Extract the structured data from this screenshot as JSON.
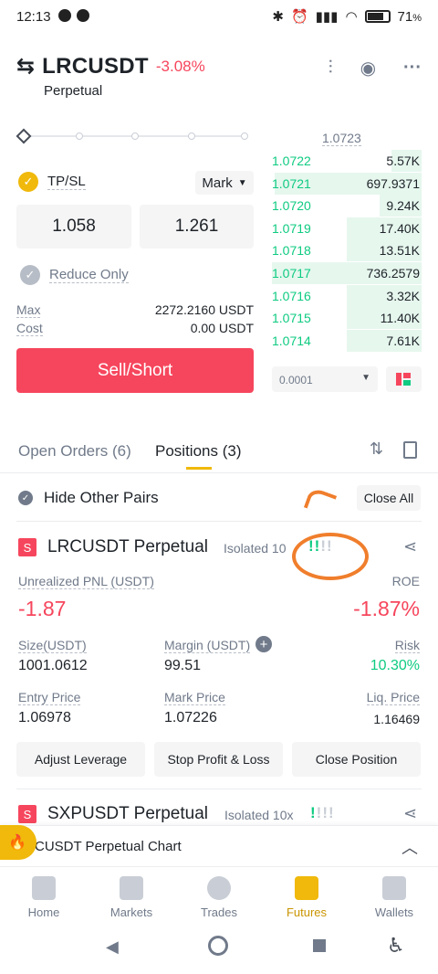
{
  "status": {
    "time": "12:13",
    "battery": "71"
  },
  "header": {
    "pair": "LRCUSDT",
    "change": "-3.08%",
    "type": "Perpetual"
  },
  "orderbook": {
    "top_price": "1.0723",
    "rows": [
      {
        "price": "1.0722",
        "qty": "5.57K",
        "depth": 0.2
      },
      {
        "price": "1.0721",
        "qty": "697.9371",
        "depth": 0.98
      },
      {
        "price": "1.0720",
        "qty": "9.24K",
        "depth": 0.28
      },
      {
        "price": "1.0719",
        "qty": "17.40K",
        "depth": 0.5
      },
      {
        "price": "1.0718",
        "qty": "13.51K",
        "depth": 0.5
      },
      {
        "price": "1.0717",
        "qty": "736.2579",
        "depth": 1.0
      },
      {
        "price": "1.0716",
        "qty": "3.32K",
        "depth": 0.5
      },
      {
        "price": "1.0715",
        "qty": "11.40K",
        "depth": 0.5
      },
      {
        "price": "1.0714",
        "qty": "7.61K",
        "depth": 0.5
      }
    ],
    "precision": "0.0001"
  },
  "form": {
    "tpsl_label": "TP/SL",
    "mark_label": "Mark",
    "tp_value": "1.058",
    "sl_value": "1.261",
    "reduce_only": "Reduce Only",
    "max_label": "Max",
    "max_value": "2272.2160 USDT",
    "cost_label": "Cost",
    "cost_value": "0.00 USDT",
    "sell_button": "Sell/Short"
  },
  "tabs": {
    "open_orders": "Open Orders (6)",
    "positions": "Positions (3)"
  },
  "filters": {
    "hide_other": "Hide Other Pairs",
    "close_all": "Close All"
  },
  "position1": {
    "badge": "S",
    "name": "LRCUSDT Perpetual",
    "mode": "Isolated 10",
    "pnl_label": "Unrealized PNL (USDT)",
    "pnl_value": "-1.87",
    "roe_label": "ROE",
    "roe_value": "-1.87%",
    "size_label": "Size(USDT)",
    "size_value": "1001.0612",
    "margin_label": "Margin (USDT)",
    "margin_value": "99.51",
    "risk_label": "Risk",
    "risk_value": "10.30%",
    "entry_label": "Entry Price",
    "entry_value": "1.06978",
    "mark_label": "Mark Price",
    "mark_value": "1.07226",
    "liq_label": "Liq. Price",
    "liq_value": "1.16469",
    "adjust_btn": "Adjust Leverage",
    "stop_btn": "Stop Profit & Loss",
    "close_btn": "Close Position"
  },
  "position2": {
    "badge": "S",
    "name": "SXPUSDT Perpetual",
    "mode": "Isolated 10x"
  },
  "chart_bar": {
    "label": "CUSDT Perpetual  Chart"
  },
  "bottom_tabs": [
    {
      "label": "Home"
    },
    {
      "label": "Markets"
    },
    {
      "label": "Trades"
    },
    {
      "label": "Futures"
    },
    {
      "label": "Wallets"
    }
  ],
  "colors": {
    "accent": "#f0b90b",
    "sell": "#f6465d",
    "buy": "#0ecb81",
    "annotation": "#f07e2c"
  }
}
